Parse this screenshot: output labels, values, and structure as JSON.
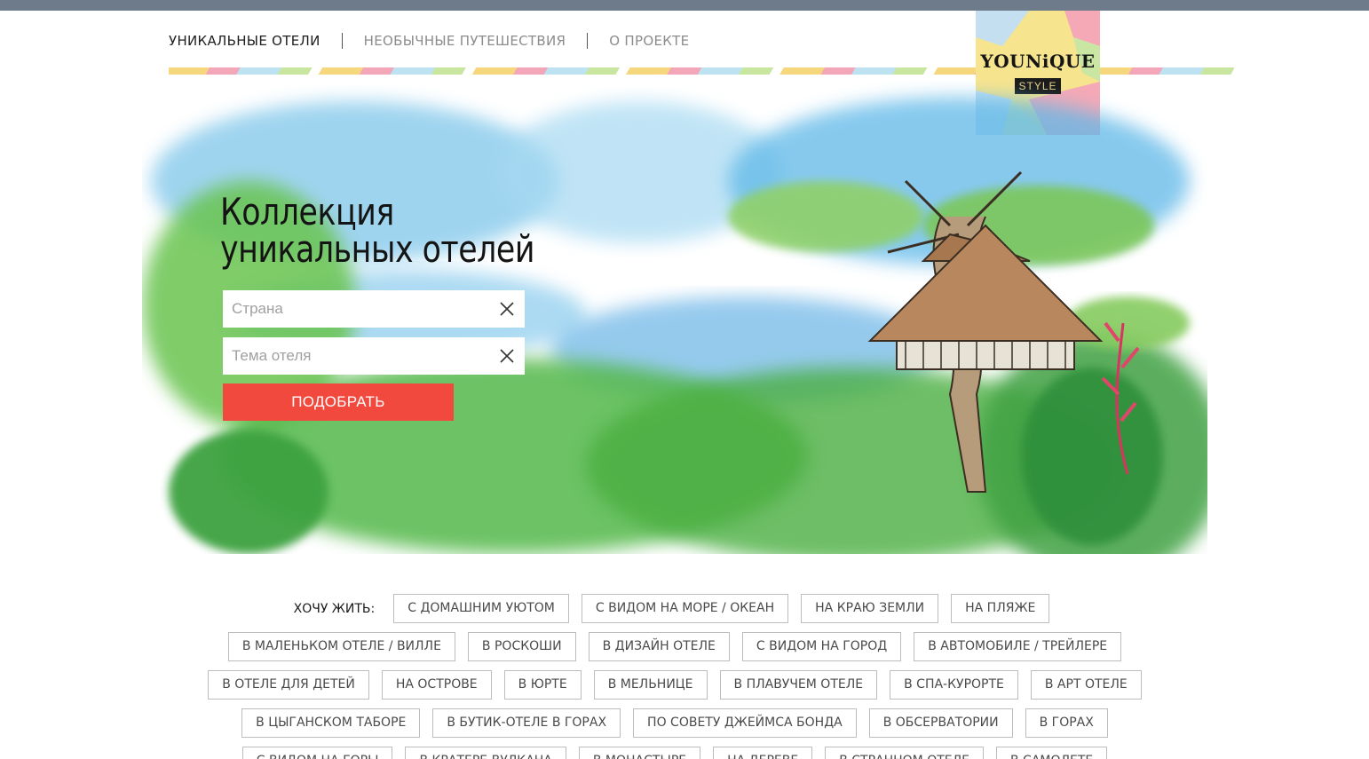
{
  "nav": {
    "items": [
      {
        "label": "УНИКАЛЬНЫЕ ОТЕЛИ",
        "active": true
      },
      {
        "label": "НЕОБЫЧНЫЕ ПУТЕШЕСТВИЯ",
        "active": false
      },
      {
        "label": "О ПРОЕКТЕ",
        "active": false
      }
    ]
  },
  "logo": {
    "name": "YOUNiQUE",
    "style": "STYLE"
  },
  "hero": {
    "title_line1": "Коллекция",
    "title_line2": "уникальных отелей",
    "country_placeholder": "Страна",
    "theme_placeholder": "Тема отеля",
    "submit_label": "ПОДОБРАТЬ"
  },
  "tags": {
    "label": "ХОЧУ ЖИТЬ:",
    "row1": [
      "С ДОМАШНИМ УЮТОМ",
      "С ВИДОМ НА МОРЕ / ОКЕАН",
      "НА КРАЮ ЗЕМЛИ",
      "НА ПЛЯЖЕ"
    ],
    "row2": [
      "В МАЛЕНЬКОМ ОТЕЛЕ / ВИЛЛЕ",
      "В РОСКОШИ",
      "В ДИЗАЙН ОТЕЛЕ",
      "С ВИДОМ НА ГОРОД",
      "В АВТОМОБИЛЕ / ТРЕЙЛЕРЕ"
    ],
    "row3": [
      "В ОТЕЛЕ ДЛЯ ДЕТЕЙ",
      "НА ОСТРОВЕ",
      "В ЮРТЕ",
      "В МЕЛЬНИЦЕ",
      "В ПЛАВУЧЕМ ОТЕЛЕ",
      "В СПА-КУРОРТЕ",
      "В АРТ ОТЕЛЕ"
    ],
    "row4": [
      "В ЦЫГАНСКОМ ТАБОРЕ",
      "В БУТИК-ОТЕЛЕ В ГОРАХ",
      "ПО СОВЕТУ ДЖЕЙМСА БОНДА",
      "В ОБСЕРВАТОРИИ",
      "В ГОРАХ"
    ],
    "row5": [
      "С ВИДОМ НА ГОРЫ",
      "В КРАТЕРЕ ВУЛКАНА",
      "В МОНАСТЫРЕ",
      "НА ДЕРЕВЕ",
      "В СТРАННОМ ОТЕЛЕ",
      "В САМОЛЕТЕ"
    ]
  },
  "colors": {
    "accent": "#f2493f",
    "topbar": "#6e7b8a"
  }
}
